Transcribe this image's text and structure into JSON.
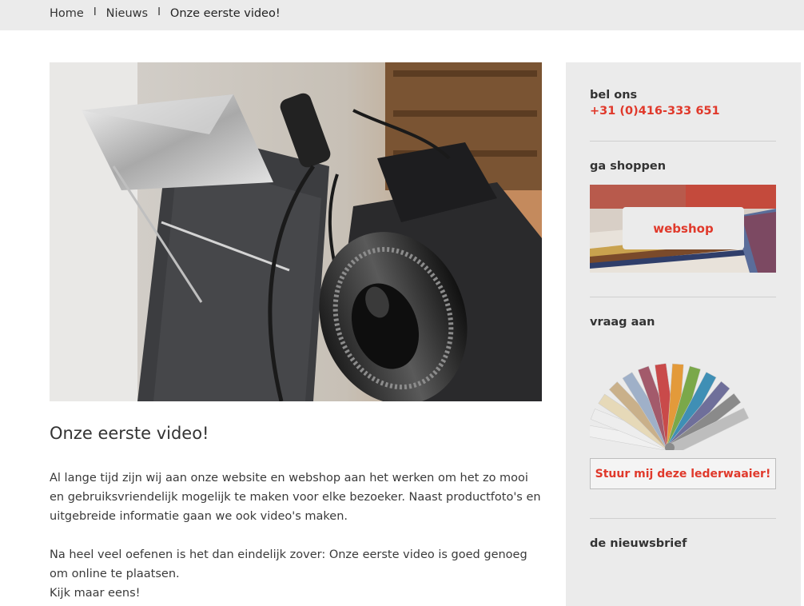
{
  "breadcrumb": {
    "home": "Home",
    "separator": "I",
    "news": "Nieuws",
    "current": "Onze eerste video!"
  },
  "article": {
    "title": "Onze eerste video!",
    "paragraph1": "Al lange tijd zijn wij aan onze website en webshop aan het werken om het zo mooi en gebruiksvriendelijk mogelijk te maken voor elke bezoeker. Naast productfoto's en uitgebreide informatie gaan we ook video's maken.",
    "paragraph2": "Na heel veel oefenen is het dan eindelijk zover: Onze eerste video is goed genoeg om online te plaatsen.",
    "paragraph3": "Kijk maar eens!"
  },
  "sidebar": {
    "call": {
      "title": "bel ons",
      "phone": "+31 (0)416-333 651"
    },
    "shop": {
      "title": "ga shoppen",
      "button": "webshop"
    },
    "request": {
      "title": "vraag aan",
      "button": "Stuur mij deze lederwaaier!"
    },
    "newsletter": {
      "title": "de nieuwsbrief"
    }
  },
  "colors": {
    "accent": "#e0392b",
    "bar_background": "#ebebeb",
    "text": "#333333"
  }
}
